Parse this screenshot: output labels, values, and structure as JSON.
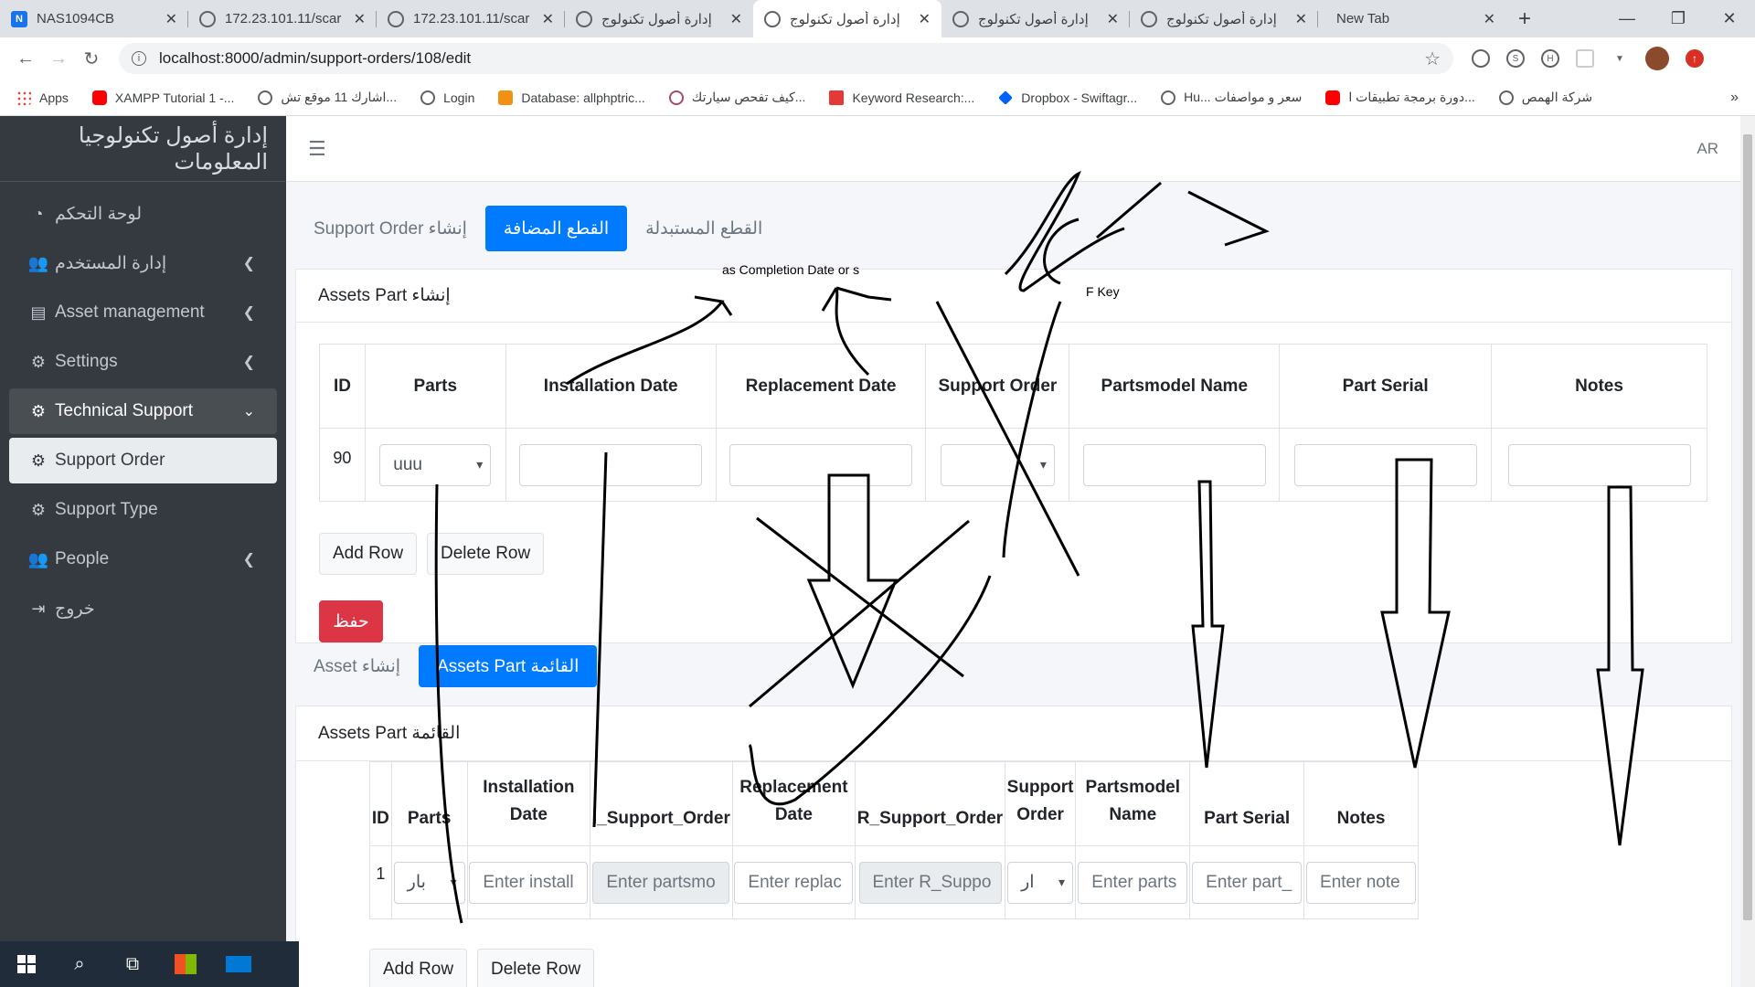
{
  "browser": {
    "tabs": [
      {
        "title": "NAS1094CB",
        "icon": "nas-icon"
      },
      {
        "title": "172.23.101.11/scar",
        "icon": "globe-icon"
      },
      {
        "title": "172.23.101.11/scar",
        "icon": "globe-icon"
      },
      {
        "title": "إدارة أصول تكنولوج",
        "icon": "globe-icon"
      },
      {
        "title": "إدارة أصول تكنولوج",
        "icon": "globe-icon",
        "active": true
      },
      {
        "title": "إدارة أصول تكنولوج",
        "icon": "globe-icon"
      },
      {
        "title": "إدارة أصول تكنولوج",
        "icon": "globe-icon"
      },
      {
        "title": "New Tab",
        "icon": ""
      }
    ],
    "url": "localhost:8000/admin/support-orders/108/edit",
    "bookmarks": [
      {
        "label": "Apps",
        "icon": "apps-grid-icon"
      },
      {
        "label": "XAMPP Tutorial 1 -...",
        "icon": "youtube-icon"
      },
      {
        "label": "اشارك 11 موقع تش...",
        "icon": "globe-icon"
      },
      {
        "label": "Login",
        "icon": "globe-icon"
      },
      {
        "label": "Database: allphptric...",
        "icon": "database-icon"
      },
      {
        "label": "كيف تفحص سيارتك...",
        "icon": "site-icon"
      },
      {
        "label": "Keyword Research:...",
        "icon": "keyword-icon"
      },
      {
        "label": "Dropbox - Swiftagr...",
        "icon": "dropbox-icon"
      },
      {
        "label": "Hu... سعر و مواصفات",
        "icon": "globe-icon"
      },
      {
        "label": "دورة برمجة تطبيقات ا...",
        "icon": "youtube-icon"
      },
      {
        "label": "شركة الهمص",
        "icon": "globe-icon"
      }
    ],
    "bookmarks_more": "»"
  },
  "sidebar": {
    "brand": "إدارة أصول تكنولوجيا المعلومات",
    "items": [
      {
        "label": "لوحة التحكم",
        "icon": "dashboard-icon",
        "chevron": false
      },
      {
        "label": "إدارة المستخدم",
        "icon": "users-icon",
        "chevron": true
      },
      {
        "label": "Asset management",
        "icon": "book-icon",
        "chevron": true
      },
      {
        "label": "Settings",
        "icon": "gears-icon",
        "chevron": true
      },
      {
        "label": "Technical Support",
        "icon": "gears-icon",
        "chevron": true,
        "open": true
      },
      {
        "label": "Support Order",
        "icon": "gears-icon",
        "chevron": false,
        "active": true
      },
      {
        "label": "Support Type",
        "icon": "gears-icon",
        "chevron": false
      },
      {
        "label": "People",
        "icon": "users-icon",
        "chevron": true
      },
      {
        "label": "خروج",
        "icon": "sign-out-icon",
        "chevron": false
      }
    ]
  },
  "topnav": {
    "lang": "AR"
  },
  "tabs1": {
    "items": [
      "Support Order إنشاء",
      "القطع المضافة",
      "القطع المستبدلة"
    ],
    "active": 1
  },
  "card1": {
    "title": "Assets Part إنشاء",
    "columns": [
      "ID",
      "Parts",
      "Installation Date",
      "Replacement Date",
      "Support Order",
      "Partsmodel Name",
      "Part Serial",
      "Notes"
    ],
    "row": {
      "id": "90",
      "parts": "uuu"
    },
    "add_row": "Add Row",
    "delete_row": "Delete Row",
    "save": "حفظ"
  },
  "tabs2": {
    "items": [
      "Asset إنشاء",
      "Assets Part القائمة"
    ],
    "active": 1
  },
  "card2": {
    "title": "Assets Part القائمة",
    "columns": [
      "ID",
      "Parts",
      "Installation Date",
      "I_Support_Order",
      "Replacement Date",
      "R_Support_Order",
      "Support Order",
      "Partsmodel Name",
      "Part Serial",
      "Notes"
    ],
    "row": {
      "id": "1",
      "parts": "بار",
      "installation_placeholder": "Enter install",
      "i_support_placeholder": "Enter partsmo",
      "replacement_placeholder": "Enter replac",
      "r_support_placeholder": "Enter R_Suppo",
      "support_order": "ار",
      "partsmodel_placeholder": "Enter parts",
      "serial_placeholder": "Enter part_",
      "notes_placeholder": "Enter note"
    },
    "add_row": "Add Row",
    "delete_row": "Delete Row"
  },
  "annotations": {
    "note1": "as Completion Date  or s",
    "note2": "F Key"
  },
  "colors": {
    "primary": "#007bff",
    "danger": "#dc3545",
    "sidebar": "#343a40"
  }
}
